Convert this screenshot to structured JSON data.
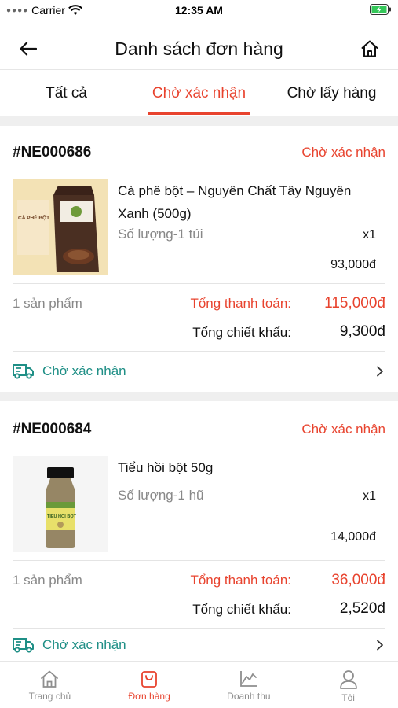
{
  "status_bar": {
    "carrier": "Carrier",
    "time": "12:35 AM",
    "wifi_icon": "wifi-icon",
    "battery_icon": "battery-charging-icon"
  },
  "header": {
    "title": "Danh sách đơn hàng",
    "back_icon": "arrow-left-icon",
    "home_icon": "home-icon"
  },
  "tabs": [
    {
      "label": "Tất cả",
      "active": false
    },
    {
      "label": "Chờ xác nhận",
      "active": true
    },
    {
      "label": "Chờ lấy hàng",
      "active": false
    }
  ],
  "orders": [
    {
      "id": "#NE000686",
      "status": "Chờ xác nhận",
      "product": {
        "name": "Cà phê bột – Nguyên Chất Tây Nguyên Xanh (500g)",
        "quantity_label": "Số lượng-1 túi",
        "multiplier": "x1",
        "price": "93,000đ",
        "thumb_text": "CÀ PHÊ BỘT"
      },
      "product_count": "1 sản phẩm",
      "total_label": "Tổng thanh toán:",
      "total_value": "115,000đ",
      "discount_label": "Tổng chiết khấu:",
      "discount_value": "9,300đ",
      "status_row_text": "Chờ xác nhận"
    },
    {
      "id": "#NE000684",
      "status": "Chờ xác nhận",
      "product": {
        "name": "Tiểu hồi bột 50g",
        "quantity_label": "Số lượng-1 hũ",
        "multiplier": "x1",
        "price": "14,000đ",
        "thumb_text": "TIỂU HỒI BỘT"
      },
      "product_count": "1 sản phẩm",
      "total_label": "Tổng thanh toán:",
      "total_value": "36,000đ",
      "discount_label": "Tổng chiết khấu:",
      "discount_value": "2,520đ",
      "status_row_text": "Chờ xác nhận"
    }
  ],
  "bottom_nav": [
    {
      "label": "Trang chủ",
      "icon": "home-icon",
      "active": false
    },
    {
      "label": "Đơn hàng",
      "icon": "shopping-bag-icon",
      "active": true
    },
    {
      "label": "Doanh thu",
      "icon": "line-chart-icon",
      "active": false
    },
    {
      "label": "Tôi",
      "icon": "user-icon",
      "active": false
    }
  ],
  "colors": {
    "accent": "#e8432e",
    "teal": "#1f8f86",
    "muted": "#888888"
  }
}
